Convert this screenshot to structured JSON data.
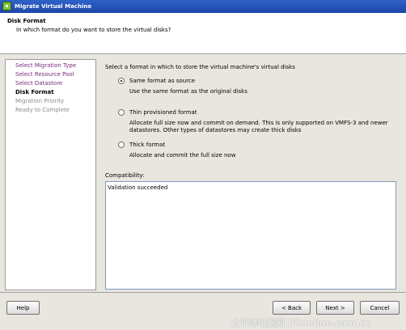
{
  "window": {
    "title": "Migrate Virtual Machine",
    "app_icon": "vmware-app-icon"
  },
  "header": {
    "title": "Disk Format",
    "subtitle": "In which format do you want to store the virtual disks?"
  },
  "steps": [
    {
      "label": "Select Migration Type",
      "state": "done"
    },
    {
      "label": "Select Resource Pool",
      "state": "done"
    },
    {
      "label": "Select Datastore",
      "state": "done"
    },
    {
      "label": "Disk Format",
      "state": "current"
    },
    {
      "label": "Migration Priority",
      "state": "pending"
    },
    {
      "label": "Ready to Complete",
      "state": "pending"
    }
  ],
  "content": {
    "intro": "Select a format in which to store the virtual machine's virtual disks",
    "options": [
      {
        "label": "Same format as source",
        "desc1": "Use the same format as the original disks",
        "desc2": "",
        "selected": true
      },
      {
        "label": "Thin provisioned format",
        "desc1": "Allocate full size now and commit on demand. This is only supported on VMFS-3 and newer",
        "desc2": "datastores. Other types of datastores may create thick disks",
        "selected": false
      },
      {
        "label": "Thick format",
        "desc1": "Allocate and commit the full size now",
        "desc2": "",
        "selected": false
      }
    ],
    "compatibility_label": "Compatibility:",
    "compatibility_message": "Validation succeeded"
  },
  "buttons": {
    "help": "Help",
    "back": "< Back",
    "next": "Next >",
    "cancel": "Cancel"
  },
  "watermark": "太平洋电脑网 PConline.com.cn"
}
